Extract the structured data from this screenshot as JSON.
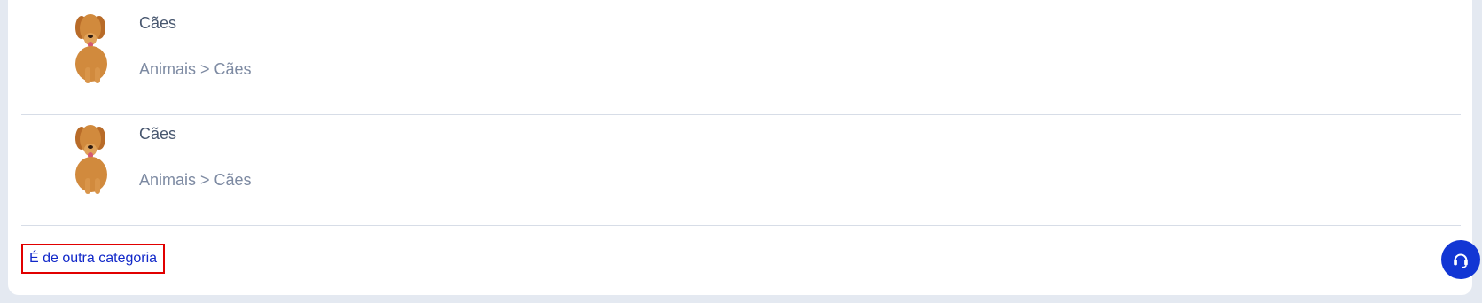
{
  "results": [
    {
      "title": "Cães",
      "path": "Animais > Cães",
      "icon": "dog-thumbnail-icon"
    },
    {
      "title": "Cães",
      "path": "Animais > Cães",
      "icon": "dog-thumbnail-icon"
    }
  ],
  "footer": {
    "other_category_label": "É de outra categoria",
    "support_icon": "headset-icon"
  },
  "colors": {
    "accent": "#1236d4",
    "link": "#1128c9",
    "highlight": "#e10000"
  }
}
